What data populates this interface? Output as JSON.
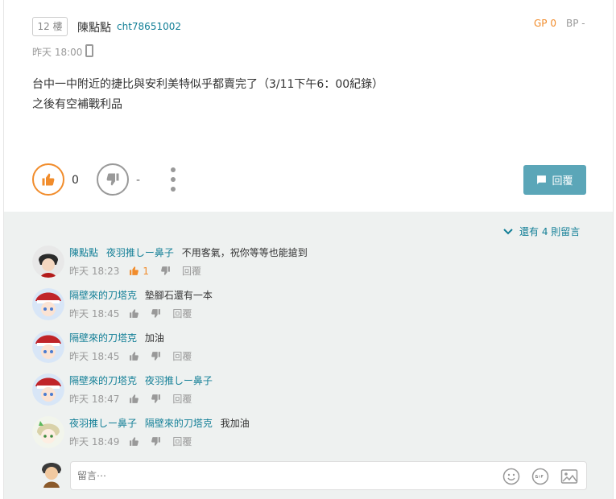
{
  "post": {
    "floor": "12 樓",
    "author": "陳點點",
    "user_id": "cht78651002",
    "gp": "GP 0",
    "bp": "BP -",
    "time": "昨天 18:00",
    "content_line1": "台中一中附近的捷比與安利美特似乎都賣完了（3/11下午6：00紀錄）",
    "content_line2": "之後有空補戰利品",
    "like_count": "0",
    "dislike_count": "-",
    "reply_label": "回覆"
  },
  "comments_section": {
    "more_comments": "還有 4 則留言",
    "comments": [
      {
        "name": "陳點點",
        "mention": "夜羽推しー鼻子",
        "text": "不用客氣，祝你等等也能搶到",
        "time": "昨天 18:23",
        "likes": "1",
        "reply": "回覆"
      },
      {
        "name": "隔壁來的刀塔克",
        "mention": "",
        "text": "墊腳石還有一本",
        "time": "昨天 18:45",
        "likes": "",
        "reply": "回覆"
      },
      {
        "name": "隔壁來的刀塔克",
        "mention": "",
        "text": "加油",
        "time": "昨天 18:45",
        "likes": "",
        "reply": "回覆"
      },
      {
        "name": "隔壁來的刀塔克",
        "mention": "夜羽推しー鼻子",
        "text": "",
        "time": "昨天 18:47",
        "likes": "",
        "reply": "回覆"
      },
      {
        "name": "夜羽推しー鼻子",
        "mention": "隔壁來的刀塔克",
        "text": "我加油",
        "time": "昨天 18:49",
        "likes": "",
        "reply": "回覆"
      }
    ],
    "input_placeholder": "留言⋯"
  },
  "colors": {
    "accent_orange": "#f18c2b",
    "link_teal": "#117e96",
    "button_teal": "#5ba6b8",
    "comment_bg": "#eef1f0"
  }
}
